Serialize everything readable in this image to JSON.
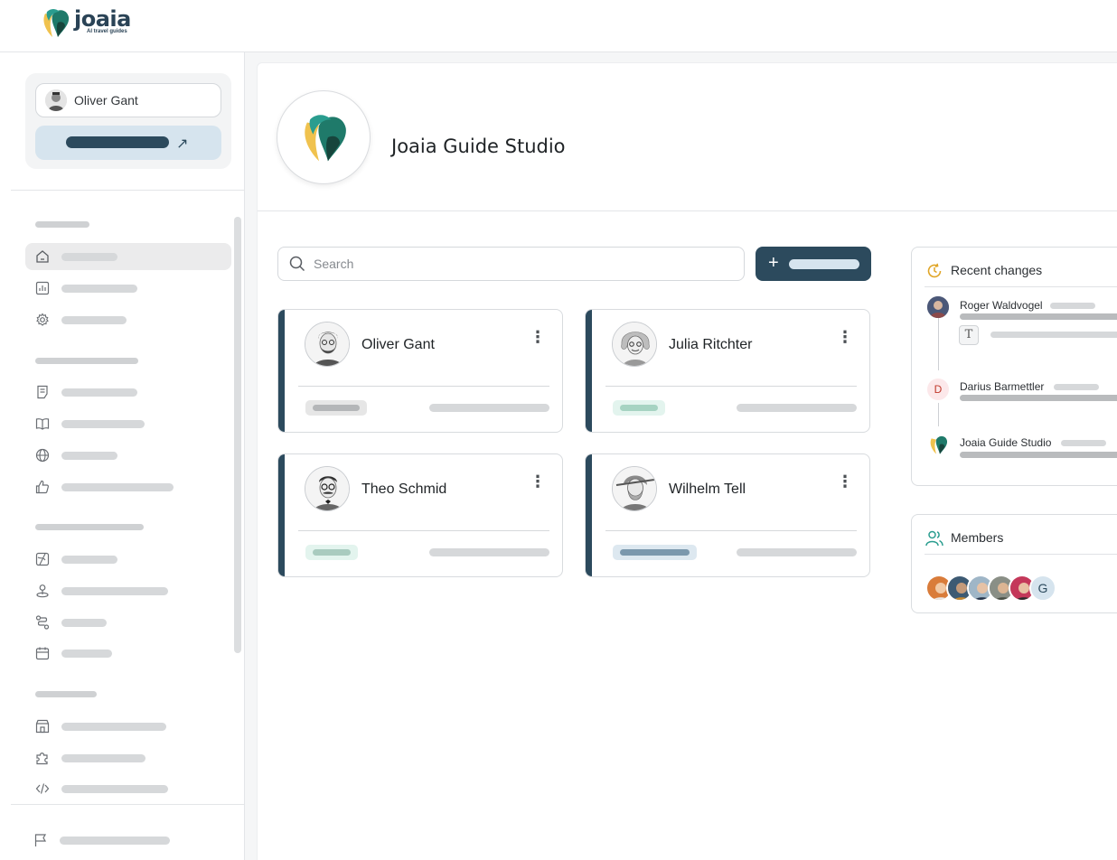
{
  "app": {
    "logo_word": "joaia",
    "logo_tagline": "AI travel guides"
  },
  "user": {
    "name": "Oliver Gant"
  },
  "studio": {
    "title": "Joaia Guide Studio"
  },
  "search": {
    "placeholder": "Search"
  },
  "guides": [
    {
      "name": "Oliver Gant",
      "badge_color": "#e6e6e6",
      "badge_inner": "#b4b6b8"
    },
    {
      "name": "Julia Ritchter",
      "badge_color": "#e3f4ee",
      "badge_inner": "#a6d3c2"
    },
    {
      "name": "Theo Schmid",
      "badge_color": "#e3f4ee",
      "badge_inner": "#a9cbbf"
    },
    {
      "name": "Wilhelm Tell",
      "badge_color": "#dde8f0",
      "badge_inner": "#7b98ad"
    }
  ],
  "recent_changes": {
    "title": "Recent changes",
    "items": [
      {
        "who": "Roger Waldvogel",
        "extra_icon": "T"
      },
      {
        "who": "Darius Barmettler",
        "initial": "D"
      },
      {
        "who": "Joaia Guide Studio"
      }
    ]
  },
  "members": {
    "title": "Members",
    "extra_initial": "G"
  },
  "colors": {
    "accent": "#2c4a5d",
    "accent_light": "#d6e4ee",
    "brand_teal": "#1f7a6a",
    "brand_yellow": "#f0c24e",
    "clock_orange": "#e0a526"
  }
}
